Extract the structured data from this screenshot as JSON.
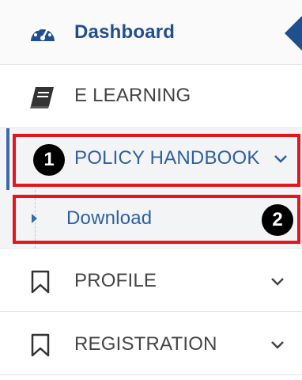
{
  "sidebar": {
    "items": [
      {
        "id": "dashboard",
        "label": "Dashboard",
        "icon": "speedometer-icon"
      },
      {
        "id": "e-learning",
        "label": "E LEARNING",
        "icon": "book-icon"
      },
      {
        "id": "policy-handbook",
        "label": "POLICY HANDBOOK",
        "icon": "",
        "expanded": true,
        "children": [
          {
            "id": "download",
            "label": "Download"
          }
        ]
      },
      {
        "id": "profile",
        "label": "PROFILE",
        "icon": "bookmark-icon"
      },
      {
        "id": "registration",
        "label": "REGISTRATION",
        "icon": "bookmark-icon"
      }
    ]
  },
  "annotations": {
    "badge1": "1",
    "badge2": "2",
    "highlight_color": "#e8141c"
  },
  "colors": {
    "accent": "#1f4f8f",
    "active_text": "#2f5f9f",
    "text": "#444444",
    "active_bg": "#f3f4f6"
  }
}
